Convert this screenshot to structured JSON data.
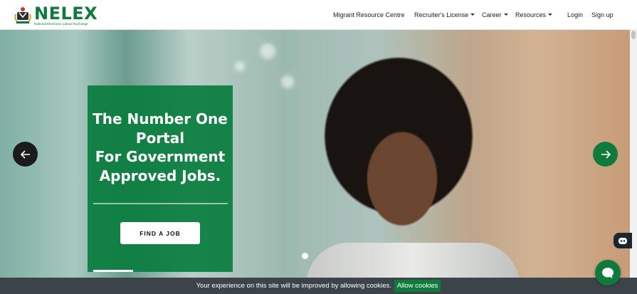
{
  "brand": {
    "name": "NELEX",
    "subtitle": "National Electronic Labour Exchange",
    "color": "#0f7a3c"
  },
  "nav": {
    "migrant": "Migrant Resource Centre",
    "recruiter": "Recruiter's License",
    "career": "Career",
    "resources": "Resources",
    "login": "Login",
    "signup": "Sign up"
  },
  "hero": {
    "headline_1": "The Number One",
    "headline_2": "Portal",
    "headline_3": "For Government",
    "headline_4": "Approved Jobs.",
    "cta": "FIND A JOB",
    "prev_icon": "arrow-left-icon",
    "next_icon": "arrow-right-icon"
  },
  "cookie": {
    "message": "Your experience on this site will be improved by allowing cookies.",
    "button": "Allow cookies"
  },
  "widgets": {
    "bot_icon": "bot-icon",
    "chat_icon": "chat-bubble-icon"
  }
}
